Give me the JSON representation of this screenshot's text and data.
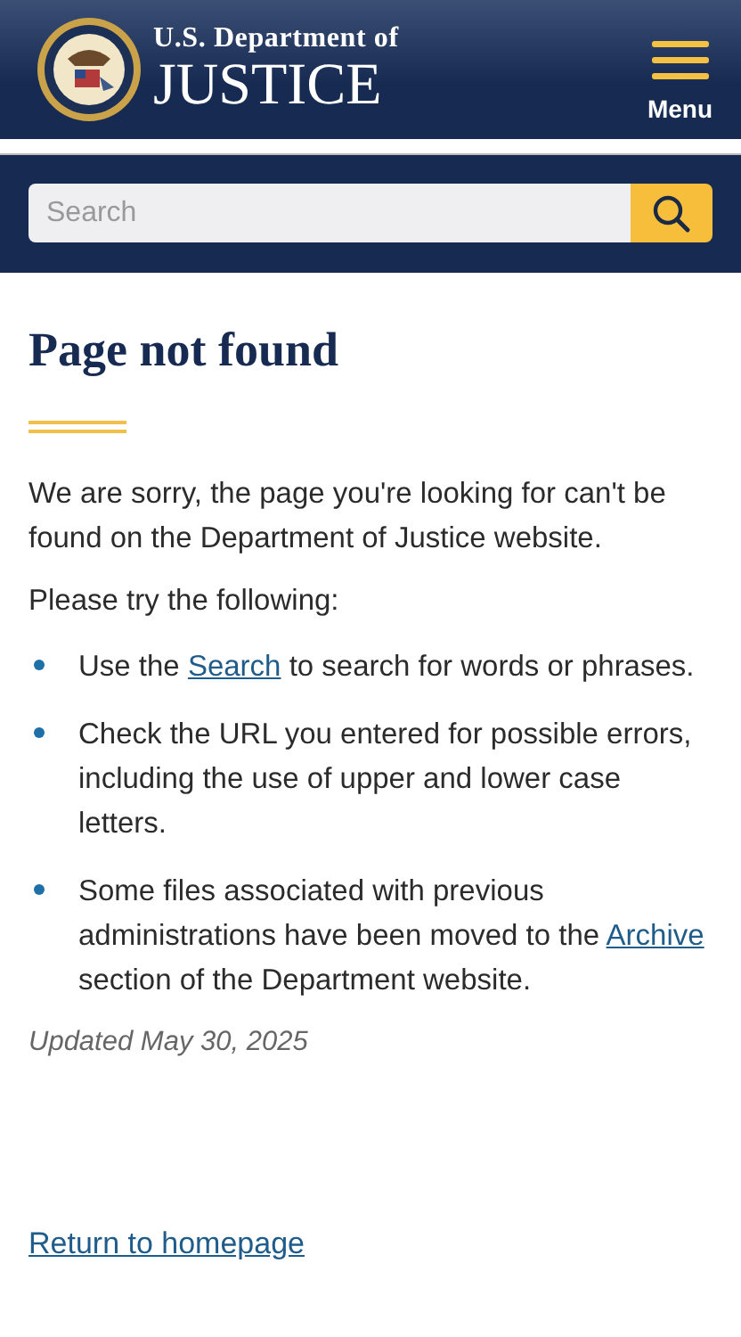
{
  "header": {
    "logo_top": "U.S. Department of",
    "logo_main": "JUSTICE",
    "menu_label": "Menu"
  },
  "search": {
    "placeholder": "Search"
  },
  "title": "Page not found",
  "intro": "We are sorry, the page you're looking for can't be found on the Department of Justice website.",
  "lead": "Please try the following:",
  "bullets": [
    {
      "before": "Use the ",
      "link": "Search",
      "after": " to search for words or phrases."
    },
    {
      "before": "Check the URL you entered for possible errors, including the use of upper and lower case letters."
    },
    {
      "before": "Some files associated with previous administrations have been moved to the ",
      "link": "Archive",
      "after": " section of the Department website."
    }
  ],
  "updated": "Updated May 30, 2025",
  "return_link": "Return to homepage"
}
